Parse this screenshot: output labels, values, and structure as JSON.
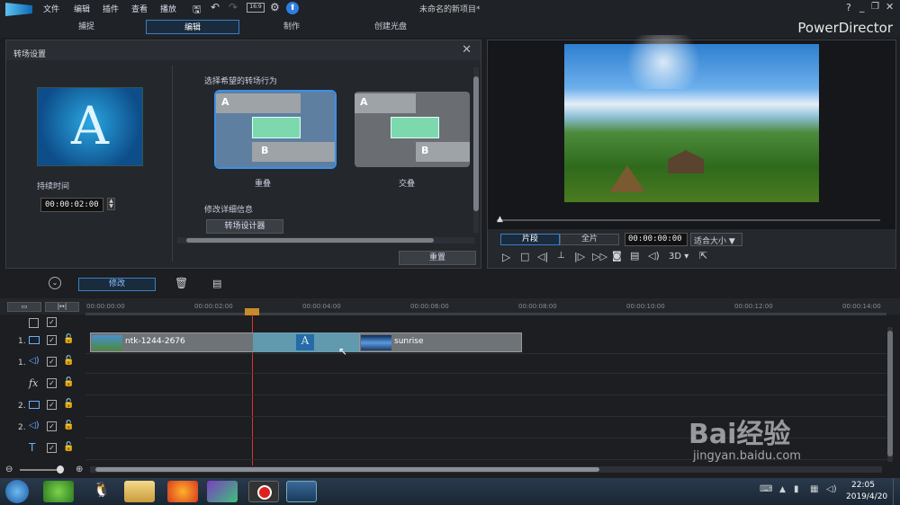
{
  "app": {
    "title": "未命名的新项目*",
    "brand": "PowerDirector"
  },
  "menu": [
    "文件",
    "编辑",
    "插件",
    "查看",
    "播放"
  ],
  "tabs": [
    "捕捉",
    "编辑",
    "制作",
    "创建光盘"
  ],
  "help": "?",
  "transition": {
    "panel_title": "转场设置",
    "duration_label": "持续时间",
    "duration_value": "00:00:02:00",
    "behavior_label": "选择希望的转场行为",
    "options": [
      {
        "label": "重叠",
        "a": "A",
        "b": "B"
      },
      {
        "label": "交叠",
        "a": "A",
        "b": "B"
      }
    ],
    "detail_label": "修改详细信息",
    "designer_button": "转场设计器",
    "reset_button": "重置",
    "thumb_letter": "A"
  },
  "preview": {
    "clip_tab": "片段",
    "full_tab": "全片",
    "timecode": "00:00:00:00",
    "fit": "适合大小",
    "threeD": "3D"
  },
  "toolbar": {
    "modify": "修改"
  },
  "ruler": [
    "00:00:00:00",
    "00:00:02:00",
    "00:00:04:00",
    "00:00:06:00",
    "00:00:08:00",
    "00:00:10:00",
    "00:00:12:00",
    "00:00:14:00"
  ],
  "tracks": [
    {
      "num": "",
      "icon": "master"
    },
    {
      "num": "1.",
      "icon": "video"
    },
    {
      "num": "1.",
      "icon": "audio"
    },
    {
      "num": "",
      "icon": "fx"
    },
    {
      "num": "2.",
      "icon": "video"
    },
    {
      "num": "2.",
      "icon": "audio"
    },
    {
      "num": "",
      "icon": "title"
    }
  ],
  "clips": {
    "clip1": "ntk-1244-2676",
    "clip2": "sunrise",
    "transition_letter": "A"
  },
  "taskbar": {
    "time": "22:05",
    "date": "2019/4/20"
  },
  "watermark": {
    "brand": "Bai经验",
    "url": "jingyan.baidu.com"
  }
}
